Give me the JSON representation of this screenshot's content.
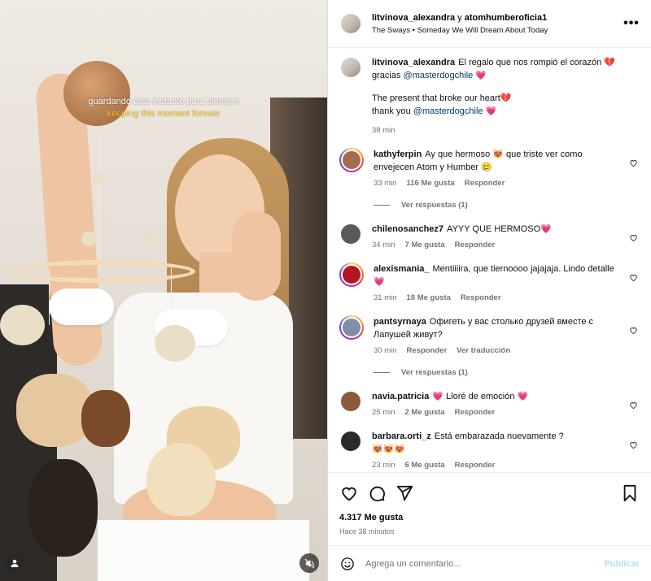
{
  "media": {
    "caption_es": "guardando este instante para siempre",
    "caption_en": "keeping this moment forever",
    "user_icon": "user-tag-icon",
    "mute_icon": "speaker-muted-icon"
  },
  "header": {
    "user1": "litvinova_alexandra",
    "connector": " y ",
    "user2": "atomhumberoficia1",
    "audio": "The Sways • Someday We Will Dream About Today",
    "more": "•••"
  },
  "caption": {
    "user": "litvinova_alexandra",
    "line1": "El regalo que nos rompió el corazón 💔",
    "line2_prefix": "gracias ",
    "mention": "@masterdogchile",
    "line2_suffix": " 💗",
    "line3": "The present that broke our heart💔",
    "line4_prefix": "thank you ",
    "line4_suffix": " 💗",
    "time": "38 min"
  },
  "comments": [
    {
      "user": "kathyferpin",
      "text": "Ay que hermoso 😻 que triste ver como envejecen Atom y Humber 🥲",
      "time": "33 min",
      "likes": "116 Me gusta",
      "reply": "Responder",
      "avatar_color": "#a46b4c"
    },
    {
      "user": "chilenosanchez7",
      "text": "AYYY QUE HERMOSO💗",
      "time": "34 min",
      "likes": "7 Me gusta",
      "reply": "Responder",
      "avatar_color": "#5a5a5a"
    },
    {
      "user": "alexismania_",
      "text": "Mentiiiira, que tiernoooo jajajaja. Lindo detalle💗",
      "time": "31 min",
      "likes": "18 Me gusta",
      "reply": "Responder",
      "avatar_color": "#b51522"
    },
    {
      "user": "pantsyrnaya",
      "text": "Офигеть у вас столько друзей вместе с Лапушей живут?",
      "time": "30 min",
      "likes": "",
      "reply": "Responder",
      "translate": "Ver traducción",
      "avatar_color": "#7e8fa6"
    },
    {
      "user": "navia.patricia",
      "text": "💗 Lloré de emoción 💗",
      "time": "25 min",
      "likes": "2 Me gusta",
      "reply": "Responder",
      "avatar_color": "#8a5a3b"
    },
    {
      "user": "barbara.orti_z",
      "text": "Está embarazada nuevamente ?",
      "text2": "😻😻😻",
      "time": "23 min",
      "likes": "6 Me gusta",
      "reply": "Responder",
      "avatar_color": "#2b2b2b"
    }
  ],
  "replies": {
    "label1": "Ver respuestas (1)",
    "label2": "Ver respuestas (1)"
  },
  "actions": {
    "likes": "4.317 Me gusta",
    "ago": "Hace 38 minutos"
  },
  "add_comment": {
    "placeholder": "Agrega un comentario...",
    "post": "Publicar"
  },
  "colors": {
    "mention": "#00376b",
    "meta": "#737373",
    "post_disabled": "#b2dffc"
  }
}
